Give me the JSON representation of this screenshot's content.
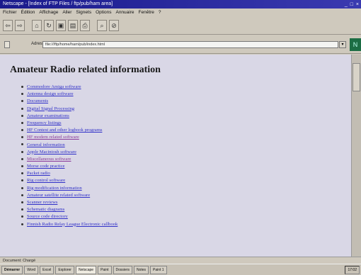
{
  "window": {
    "title": "Netscape - [Index of FTP Files / ftp/pub/ham area]",
    "controls": "_ □ ×"
  },
  "menu": [
    "Fichier",
    "Édition",
    "Affichage",
    "Aller",
    "Signets",
    "Options",
    "Annuaire",
    "Fenêtre",
    "?"
  ],
  "toolbar": {
    "buttons": [
      {
        "name": "back-button",
        "glyph": "⇦"
      },
      {
        "name": "forward-button",
        "glyph": "⇨"
      },
      {
        "name": "home-button",
        "glyph": "⌂"
      },
      {
        "name": "reload-button",
        "glyph": "↻"
      },
      {
        "name": "images-button",
        "glyph": "▣"
      },
      {
        "name": "open-button",
        "glyph": "▤"
      },
      {
        "name": "print-button",
        "glyph": "⎙"
      },
      {
        "name": "find-button",
        "glyph": "⌕"
      },
      {
        "name": "stop-button",
        "glyph": "⊘"
      }
    ]
  },
  "address": {
    "label": "Adresse:",
    "value": "file:///ftp/home/ham/pub/index.html",
    "logo_glyph": "N"
  },
  "content": {
    "title": "Amateur Radio related information",
    "links": [
      {
        "text": "Commodore Amiga software",
        "visited": false
      },
      {
        "text": "Antenna design software",
        "visited": false
      },
      {
        "text": "Documents",
        "visited": false
      },
      {
        "text": "Digital Signal Processing",
        "visited": false
      },
      {
        "text": "Amateur examinations",
        "visited": false
      },
      {
        "text": "Frequency listings",
        "visited": false
      },
      {
        "text": "HF Contest and other logbook programs",
        "visited": false
      },
      {
        "text": "HF modem related software",
        "visited": true
      },
      {
        "text": "General information",
        "visited": false
      },
      {
        "text": "Apple Macintosh software",
        "visited": false
      },
      {
        "text": "Miscellaneous software",
        "visited": true
      },
      {
        "text": "Morse code practice",
        "visited": false
      },
      {
        "text": "Packet radio",
        "visited": false
      },
      {
        "text": "Rig control software",
        "visited": false
      },
      {
        "text": "Rig modification information",
        "visited": false
      },
      {
        "text": "Amateur satellite related software",
        "visited": false
      },
      {
        "text": "Scanner reviews",
        "visited": false
      },
      {
        "text": "Schematic diagrams",
        "visited": false
      },
      {
        "text": "Source code directory",
        "visited": false
      },
      {
        "text": "Finnish Radio Relay League Electronic callbook",
        "visited": false
      }
    ]
  },
  "status": {
    "text": "Document: Chargé"
  },
  "taskbar": {
    "items": [
      {
        "label": "Démarrer",
        "start": true,
        "active": false
      },
      {
        "label": "Word",
        "start": false,
        "active": false
      },
      {
        "label": "Excel",
        "start": false,
        "active": false
      },
      {
        "label": "Explorer",
        "start": false,
        "active": false
      },
      {
        "label": "Netscape",
        "start": false,
        "active": true
      },
      {
        "label": "Paint",
        "start": false,
        "active": false
      },
      {
        "label": "Dossiers",
        "start": false,
        "active": false
      },
      {
        "label": "Notes",
        "start": false,
        "active": false
      },
      {
        "label": "Paint 1",
        "start": false,
        "active": false
      }
    ],
    "clock": "17:02"
  }
}
